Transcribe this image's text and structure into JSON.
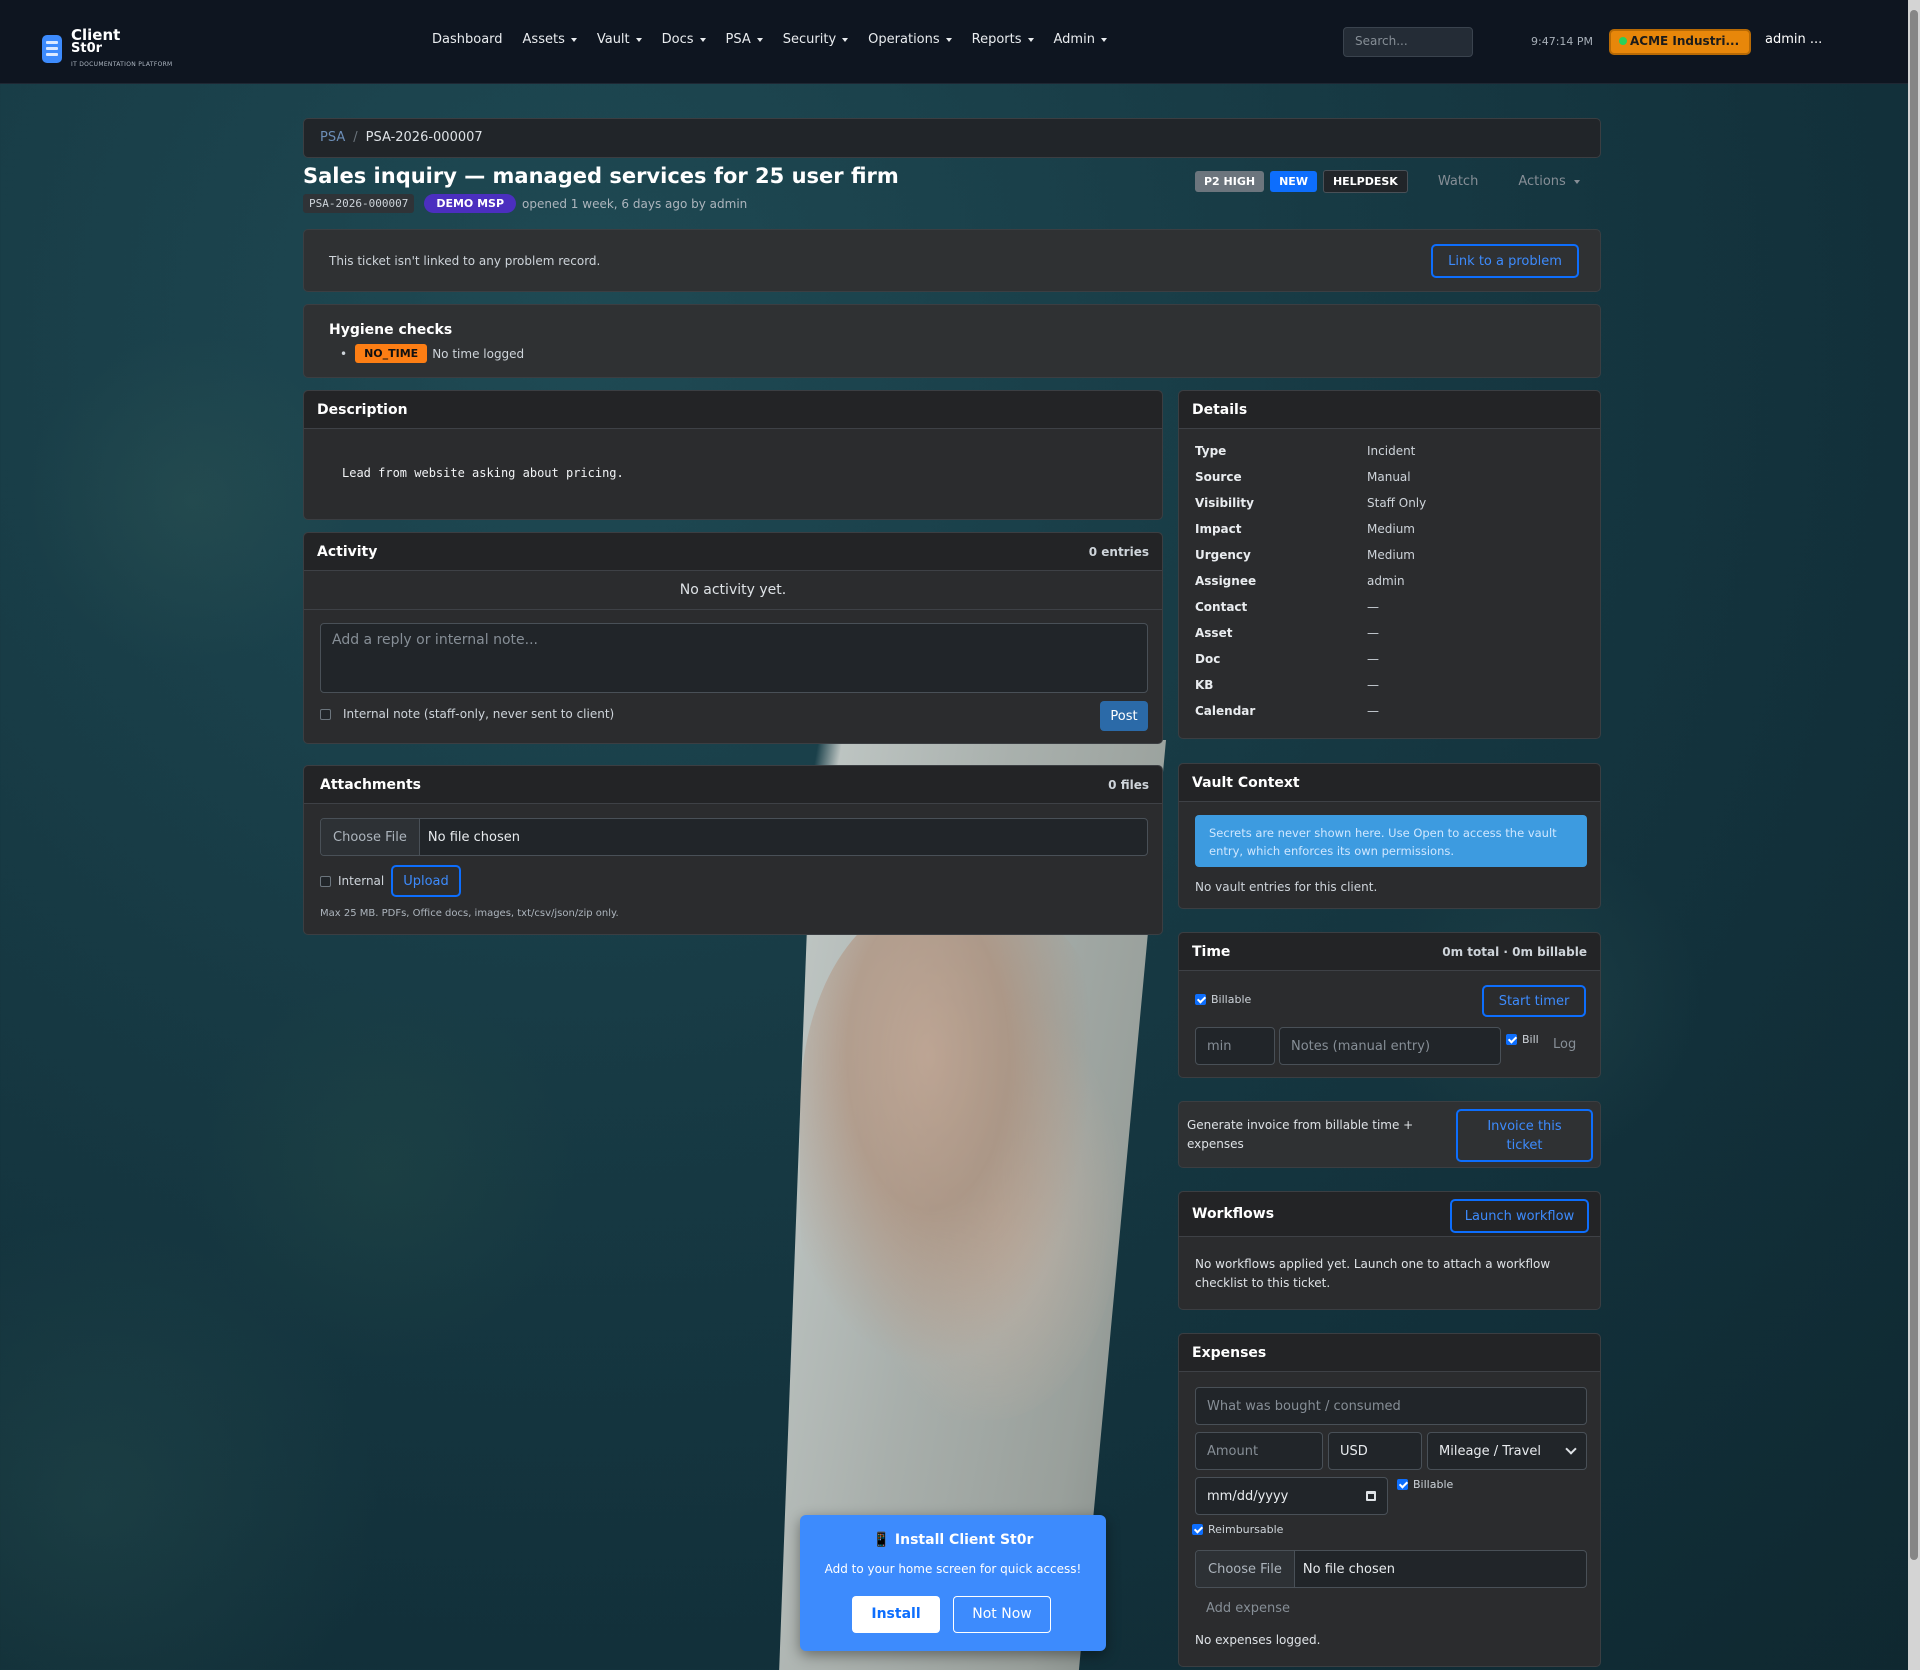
{
  "app": {
    "name_line1": "Client",
    "name_line2": "St0r",
    "tagline": "IT DOCUMENTATION PLATFORM"
  },
  "nav": {
    "items": [
      {
        "label": "Dashboard",
        "dropdown": false
      },
      {
        "label": "Assets",
        "dropdown": true
      },
      {
        "label": "Vault",
        "dropdown": true
      },
      {
        "label": "Docs",
        "dropdown": true
      },
      {
        "label": "PSA",
        "dropdown": true
      },
      {
        "label": "Security",
        "dropdown": true
      },
      {
        "label": "Operations",
        "dropdown": true
      },
      {
        "label": "Reports",
        "dropdown": true
      },
      {
        "label": "Admin",
        "dropdown": true
      }
    ],
    "search_placeholder": "Search...",
    "clock": "9:47:14 PM",
    "client": "ACME Industri...",
    "user": "admin ..."
  },
  "breadcrumb": {
    "root": "PSA",
    "current": "PSA-2026-000007"
  },
  "ticket": {
    "title": "Sales inquiry — managed services for 25 user firm",
    "number": "PSA-2026-000007",
    "org_badge": "DEMO MSP",
    "opened_text": "opened 1 week, 6 days ago by admin",
    "priority_badge": "P2 HIGH",
    "status_badge": "NEW",
    "queue_badge": "HELPDESK",
    "watch_label": "Watch",
    "actions_label": "Actions"
  },
  "problem": {
    "text": "This ticket isn't linked to any problem record.",
    "button": "Link to a problem"
  },
  "hygiene": {
    "title": "Hygiene checks",
    "items": [
      {
        "code": "NO_TIME",
        "text": "No time logged"
      }
    ]
  },
  "description": {
    "title": "Description",
    "body": "Lead from website asking about pricing."
  },
  "activity": {
    "title": "Activity",
    "count": "0 entries",
    "empty": "No activity yet.",
    "reply_placeholder": "Add a reply or internal note...",
    "internal_label": "Internal note (staff-only, never sent to client)",
    "post": "Post"
  },
  "attachments": {
    "title": "Attachments",
    "count": "0 files",
    "choose": "Choose File",
    "no_file": "No file chosen",
    "internal": "Internal",
    "upload": "Upload",
    "hint": "Max 25 MB. PDFs, Office docs, images, txt/csv/json/zip only."
  },
  "details": {
    "title": "Details",
    "rows": [
      {
        "k": "Type",
        "v": "Incident"
      },
      {
        "k": "Source",
        "v": "Manual"
      },
      {
        "k": "Visibility",
        "v": "Staff Only"
      },
      {
        "k": "Impact",
        "v": "Medium"
      },
      {
        "k": "Urgency",
        "v": "Medium"
      },
      {
        "k": "Assignee",
        "v": "admin"
      },
      {
        "k": "Contact",
        "v": "—"
      },
      {
        "k": "Asset",
        "v": "—"
      },
      {
        "k": "Doc",
        "v": "—"
      },
      {
        "k": "KB",
        "v": "—"
      },
      {
        "k": "Calendar",
        "v": "—"
      }
    ]
  },
  "vault": {
    "title": "Vault Context",
    "notice": "Secrets are never shown here. Use Open to access the vault entry, which enforces its own permissions.",
    "empty": "No vault entries for this client."
  },
  "time": {
    "title": "Time",
    "summary": "0m total · 0m billable",
    "billable": "Billable",
    "start": "Start timer",
    "min_placeholder": "min",
    "notes_placeholder": "Notes (manual entry)",
    "bill": "Bill",
    "log": "Log"
  },
  "invoice": {
    "text": "Generate invoice from billable time + expenses",
    "button": "Invoice this ticket"
  },
  "workflows": {
    "title": "Workflows",
    "button": "Launch workflow",
    "empty": "No workflows applied yet. Launch one to attach a workflow checklist to this ticket."
  },
  "expenses": {
    "title": "Expenses",
    "what_placeholder": "What was bought / consumed",
    "amount_placeholder": "Amount",
    "currency": "USD",
    "category": "Mileage / Travel",
    "date_placeholder": "mm/dd/yyyy",
    "billable": "Billable",
    "reimbursable": "Reimbursable",
    "choose": "Choose File",
    "no_file": "No file chosen",
    "add": "Add expense",
    "empty": "No expenses logged."
  },
  "pwa": {
    "icon": "📱",
    "title": "Install Client St0r",
    "text": "Add to your home screen for quick access!",
    "install": "Install",
    "not_now": "Not Now"
  }
}
